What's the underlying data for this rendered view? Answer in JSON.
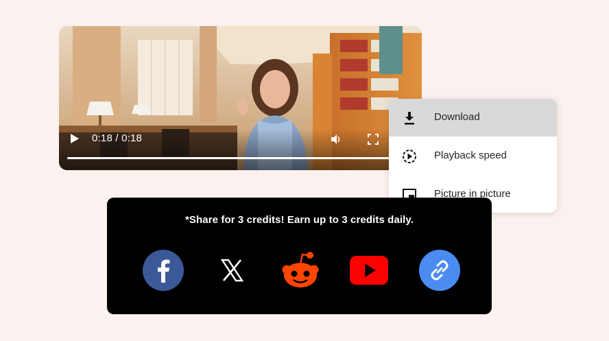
{
  "player": {
    "time_display": "0:18 / 0:18",
    "progress": 1.0
  },
  "menu": {
    "items": [
      {
        "label": "Download",
        "icon": "download-icon",
        "highlighted": true
      },
      {
        "label": "Playback speed",
        "icon": "playback-speed-icon",
        "highlighted": false
      },
      {
        "label": "Picture in picture",
        "icon": "picture-in-picture-icon",
        "highlighted": false
      }
    ]
  },
  "share": {
    "text": "*Share for 3 credits! Earn up to 3 credits daily.",
    "buttons": [
      {
        "name": "facebook",
        "icon": "facebook-icon",
        "color": "#3b5998"
      },
      {
        "name": "x",
        "icon": "x-icon",
        "color": "#000000"
      },
      {
        "name": "reddit",
        "icon": "reddit-icon",
        "color": "#ff4500"
      },
      {
        "name": "youtube",
        "icon": "youtube-icon",
        "color": "#ff0000"
      },
      {
        "name": "copy-link",
        "icon": "link-icon",
        "color": "#4a8cf0"
      }
    ]
  },
  "colors": {
    "background": "#fbf1ef",
    "share_bg": "#000000",
    "menu_highlight": "#d9d9d9"
  }
}
